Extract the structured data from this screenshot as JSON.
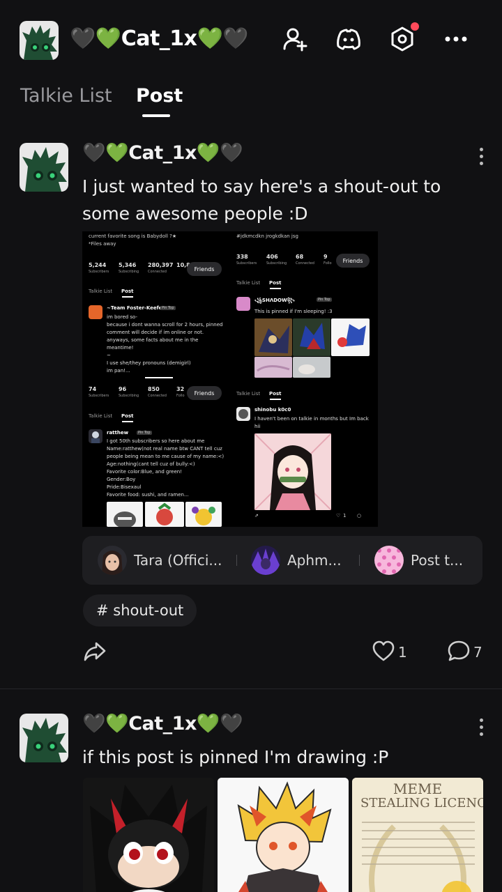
{
  "header": {
    "username": "🖤💚Cat_1x💚🖤",
    "icons": [
      "add-user-icon",
      "discord-icon",
      "settings-icon",
      "more-icon"
    ]
  },
  "tabs": [
    {
      "label": "Talkie List",
      "active": false
    },
    {
      "label": "Post",
      "active": true
    }
  ],
  "post1": {
    "author": "🖤💚Cat_1x💚🖤",
    "text": "I just wanted to say here's a shout-out to some awesome people :D",
    "screenshots": {
      "left_top": {
        "line1": "current favorite song is Babydoll ?★",
        "line2": "*Files away",
        "stats": [
          {
            "value": "5,244",
            "label": "Subscribers"
          },
          {
            "value": "5,346",
            "label": "Subscribing"
          },
          {
            "value": "280,397",
            "label": "Connected"
          },
          {
            "value": "10,8",
            "label": "Follo"
          }
        ],
        "friends": "Friends",
        "tab1": "Talkie List",
        "tab2": "Post",
        "poster": "~Team Foster-Keefe",
        "pin": "Pin Top",
        "lines": [
          "im bored so-",
          "because i dont wanna scroll for 2 hours, pinned",
          "comment will decide if im online or not.",
          "anyways, some facts about me in the",
          "meantime!",
          "~",
          "I use she/they pronouns (demigirl)",
          "im pan!..."
        ]
      },
      "left_bottom": {
        "stats": [
          {
            "value": "74",
            "label": "Subscribers"
          },
          {
            "value": "96",
            "label": "Subscribing"
          },
          {
            "value": "850",
            "label": "Connected"
          },
          {
            "value": "32",
            "label": "Follo"
          }
        ],
        "friends": "Friends",
        "tab1": "Talkie List",
        "tab2": "Post",
        "poster": "ratthew",
        "pin": "Pin Top",
        "lines": [
          "I got 50th subscribers so here about me",
          "Name:ratthew(not real name btw CANT tell cuz",
          "people being mean to me cause of my name:<)",
          "Age:nothing(cant tell cuz of bully:<)",
          "Favorite color:Blue, and green!",
          "Gender:Boy",
          "Pride:Bisexaul",
          "Favorite food: sushi, and ramen..."
        ]
      },
      "right_top": {
        "line1": "#jdkmcdkn jrogkdkan jsg",
        "stats": [
          {
            "value": "338",
            "label": "Subscribers"
          },
          {
            "value": "406",
            "label": "Subscribing"
          },
          {
            "value": "68",
            "label": "Connected"
          },
          {
            "value": "9",
            "label": "Follo"
          }
        ],
        "friends": "Friends",
        "tab1": "Talkie List",
        "tab2": "Post",
        "poster": "꧁SHΛDOW꧂",
        "pin": "Pin Top",
        "line": "This is pinned if I'm sleeping! :3"
      },
      "right_bottom": {
        "tab1": "Talkie List",
        "tab2": "Post",
        "poster": "shinobu k0c0",
        "line1": "I haven't been on talkie in months but Im back",
        "line2": "hii",
        "likes": "1"
      }
    },
    "mentions": [
      {
        "label": "Tara (Offici...",
        "avatar": "avatar-tara"
      },
      {
        "label": "Aphm...",
        "avatar": "avatar-aphm"
      },
      {
        "label": "Post t...",
        "avatar": "avatar-post"
      }
    ],
    "tag": "# shout-out",
    "likes": "1",
    "comments": "7"
  },
  "post2": {
    "author": "🖤💚Cat_1x💚🖤",
    "text": "if this post is pinned I'm drawing :P",
    "image3_title1": "MEME",
    "image3_title2": "STEALING LICENC"
  },
  "colors": {
    "background": "#111113",
    "card": "#1e1e21",
    "notification": "#ff4a5a",
    "accent_green": "#2e8b57"
  }
}
